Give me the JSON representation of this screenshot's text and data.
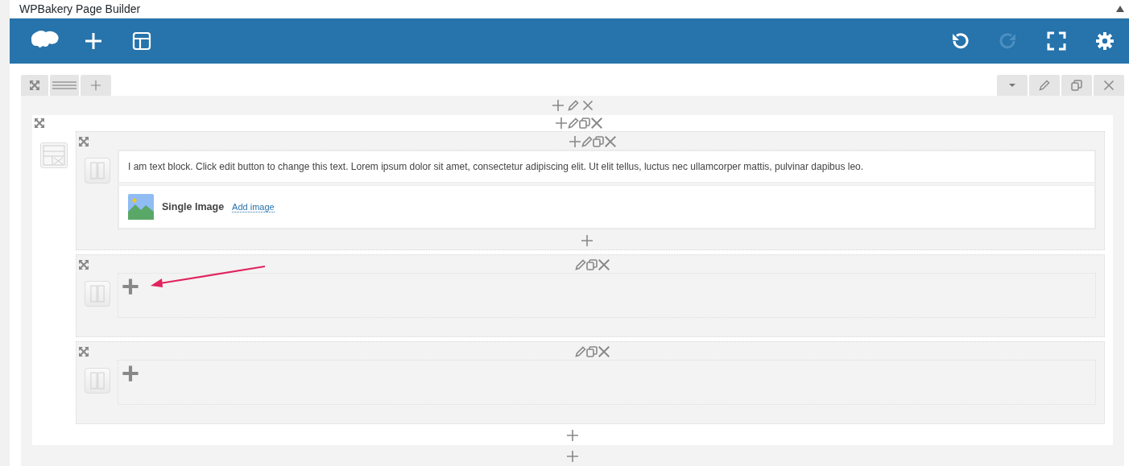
{
  "panel": {
    "title": "WPBakery Page Builder",
    "collapsed": false
  },
  "toolbar_left": [
    {
      "kind": "logo"
    },
    {
      "kind": "add"
    },
    {
      "kind": "templates"
    }
  ],
  "toolbar_right": [
    {
      "kind": "undo",
      "disabled": false
    },
    {
      "kind": "redo",
      "disabled": true
    },
    {
      "kind": "fullscreen",
      "disabled": false
    },
    {
      "kind": "settings",
      "disabled": false
    }
  ],
  "inner_rows": [
    {
      "add_control": true,
      "arrow": false,
      "elements": [
        {
          "kind": "text",
          "text": "I am text block. Click edit button to change this text. Lorem ipsum dolor sit amet, consectetur adipiscing elit. Ut elit tellus, luctus nec ullamcorper mattis, pulvinar dapibus leo."
        },
        {
          "kind": "image",
          "title": "Single Image",
          "link": "Add image"
        }
      ]
    },
    {
      "add_control": false,
      "arrow": true
    },
    {
      "add_control": false,
      "arrow": false
    }
  ]
}
